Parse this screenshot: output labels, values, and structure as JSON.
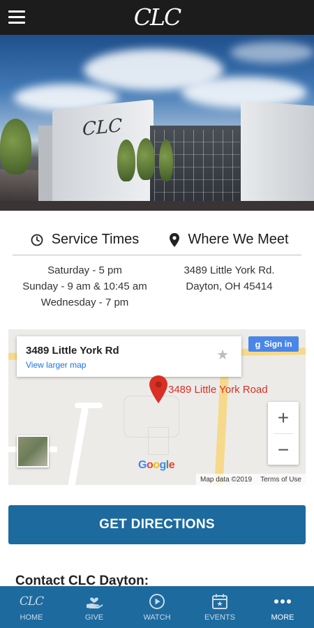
{
  "app": {
    "logo_text": "CLC"
  },
  "hero": {
    "building_logo_text": "CLC"
  },
  "info": {
    "service_times": {
      "heading": "Service Times",
      "icon": "clock-icon",
      "lines": [
        "Saturday - 5 pm",
        "Sunday - 9 am & 10:45 am",
        "Wednesday - 7 pm"
      ]
    },
    "where_we_meet": {
      "heading": "Where We Meet",
      "icon": "location-pin-icon",
      "lines": [
        "3489 Little York Rd.",
        "Dayton, OH 45414"
      ]
    }
  },
  "map": {
    "card_title": "3489 Little York Rd",
    "card_link": "View larger map",
    "sign_in_label": "Sign in",
    "pin_label": "3489 Little York Road",
    "zoom_in": "+",
    "zoom_out": "−",
    "google_logo": "Google",
    "attribution": "Map data ©2019",
    "terms": "Terms of Use"
  },
  "directions_button": "GET DIRECTIONS",
  "contact_heading": "Contact CLC Dayton:",
  "bottom_nav": [
    {
      "label": "HOME",
      "icon": "clc-logo-icon",
      "active": false
    },
    {
      "label": "GIVE",
      "icon": "heart-hand-icon",
      "active": false
    },
    {
      "label": "WATCH",
      "icon": "play-circle-icon",
      "active": false
    },
    {
      "label": "EVENTS",
      "icon": "calendar-icon",
      "active": false
    },
    {
      "label": "MORE",
      "icon": "more-dots-icon",
      "active": true
    }
  ],
  "colors": {
    "topbar": "#1c1c1c",
    "accent_blue": "#1d6a9e",
    "map_pin": "#d93025",
    "link_blue": "#1a73e8"
  }
}
